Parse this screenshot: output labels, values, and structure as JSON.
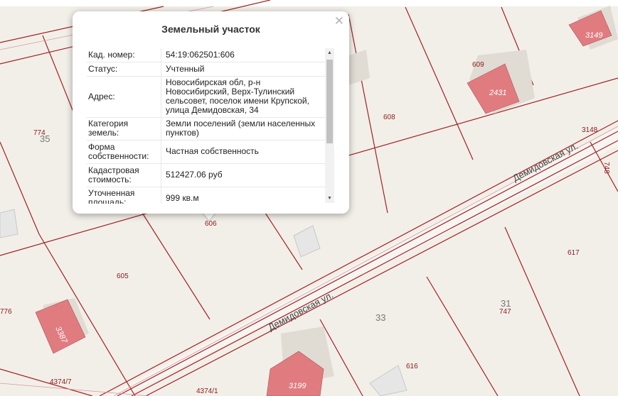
{
  "popup": {
    "title": "Земельный участок",
    "close_icon": "close-icon",
    "rows": [
      {
        "key": "Кад. номер:",
        "value": "54:19:062501:606"
      },
      {
        "key": "Статус:",
        "value": "Учтенный"
      },
      {
        "key": "Адрес:",
        "value": "Новосибирская обл, р-н Новосибирский, Верх-Тулинский сельсовет, поселок имени Крупской, улица Демидовская, 34"
      },
      {
        "key": "Категория земель:",
        "value": "Земли поселений (земли населенных пунктов)"
      },
      {
        "key": "Форма собственности:",
        "value": "Частная собственность"
      },
      {
        "key": "Кадастровая стоимость:",
        "value": "512427.06 руб"
      },
      {
        "key": "Уточненная площадь:",
        "value": "999 кв.м"
      }
    ]
  },
  "map": {
    "street_name": "Демидовская ул.",
    "parcel_labels": {
      "p606": "606",
      "p605": "605",
      "p608": "608",
      "p609": "609",
      "p617": "617",
      "p616": "616",
      "p774": "774",
      "p776": "776",
      "p747": "747",
      "p748": "748",
      "p3148": "3148",
      "p4374_7": "4374/7",
      "p4374_1": "4374/1"
    },
    "house_numbers": {
      "h35": "35",
      "h33": "33",
      "h31": "31"
    },
    "building_labels": {
      "b2431": "2431",
      "b3149": "3149",
      "b3199": "3199",
      "b3387": "3387"
    },
    "colors": {
      "boundary": "#a32222",
      "building_fill": "#e07c80",
      "building_shadow": "#e0dbd3",
      "background": "#f2efe9"
    }
  }
}
